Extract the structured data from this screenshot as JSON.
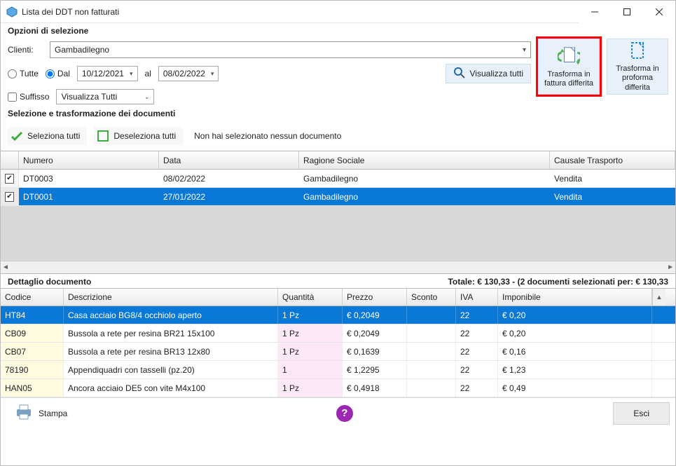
{
  "window": {
    "title": "Lista dei DDT non fatturati"
  },
  "opts": {
    "header": "Opzioni di selezione",
    "clienti_label": "Clienti:",
    "clienti_value": "Gambadilegno",
    "tutte_label": "Tutte",
    "dal_label": "Dal",
    "al_label": "al",
    "date_from": "10/12/2021",
    "date_to": "08/02/2022",
    "suffisso_label": "Suffisso",
    "suffisso_combo": "Visualizza Tutti",
    "visualizza_tutti_btn": "Visualizza tutti",
    "fattura_btn": "Trasforma in fattura differita",
    "proforma_btn": "Trasforma in proforma differita"
  },
  "sel": {
    "header": "Selezione e trasformazione dei documenti",
    "select_all": "Seleziona tutti",
    "deselect_all": "Deseleziona tutti",
    "status": "Non hai selezionato nessun documento"
  },
  "grid": {
    "cols": {
      "numero": "Numero",
      "data": "Data",
      "ragione": "Ragione Sociale",
      "causale": "Causale Trasporto"
    },
    "rows": [
      {
        "checked": true,
        "numero": "DT0003",
        "data": "08/02/2022",
        "ragione": "Gambadilegno",
        "causale": "Vendita",
        "selected": false
      },
      {
        "checked": true,
        "numero": "DT0001",
        "data": "27/01/2022",
        "ragione": "Gambadilegno",
        "causale": "Vendita",
        "selected": true
      }
    ]
  },
  "detail": {
    "header": "Dettaglio documento",
    "totale": "Totale: € 130,33 - (2 documenti selezionati per: € 130,33",
    "cols": {
      "codice": "Codice",
      "descrizione": "Descrizione",
      "quantita": "Quantità",
      "prezzo": "Prezzo",
      "sconto": "Sconto",
      "iva": "IVA",
      "imponibile": "Imponibile"
    },
    "rows": [
      {
        "codice": "HT84",
        "descr": "Casa acciaio BG8/4 occhiolo aperto",
        "qta": "1 Pz",
        "prezzo": "€ 0,2049",
        "sconto": "",
        "iva": "22",
        "imp": "€ 0,20",
        "selected": true
      },
      {
        "codice": "CB09",
        "descr": "Bussola a rete per resina BR21  15x100",
        "qta": "1 Pz",
        "prezzo": "€ 0,2049",
        "sconto": "",
        "iva": "22",
        "imp": "€ 0,20",
        "selected": false
      },
      {
        "codice": "CB07",
        "descr": "Bussola a rete per resina BR13  12x80",
        "qta": "1 Pz",
        "prezzo": "€ 0,1639",
        "sconto": "",
        "iva": "22",
        "imp": "€ 0,16",
        "selected": false
      },
      {
        "codice": "78190",
        "descr": "Appendiquadri con tasselli (pz.20)",
        "qta": "1",
        "prezzo": "€ 1,2295",
        "sconto": "",
        "iva": "22",
        "imp": "€ 1,23",
        "selected": false
      },
      {
        "codice": "HAN05",
        "descr": "Ancora acciaio DE5 con vite M4x100",
        "qta": "1 Pz",
        "prezzo": "€ 0,4918",
        "sconto": "",
        "iva": "22",
        "imp": "€ 0,49",
        "selected": false
      }
    ]
  },
  "footer": {
    "stampa": "Stampa",
    "esci": "Esci"
  }
}
